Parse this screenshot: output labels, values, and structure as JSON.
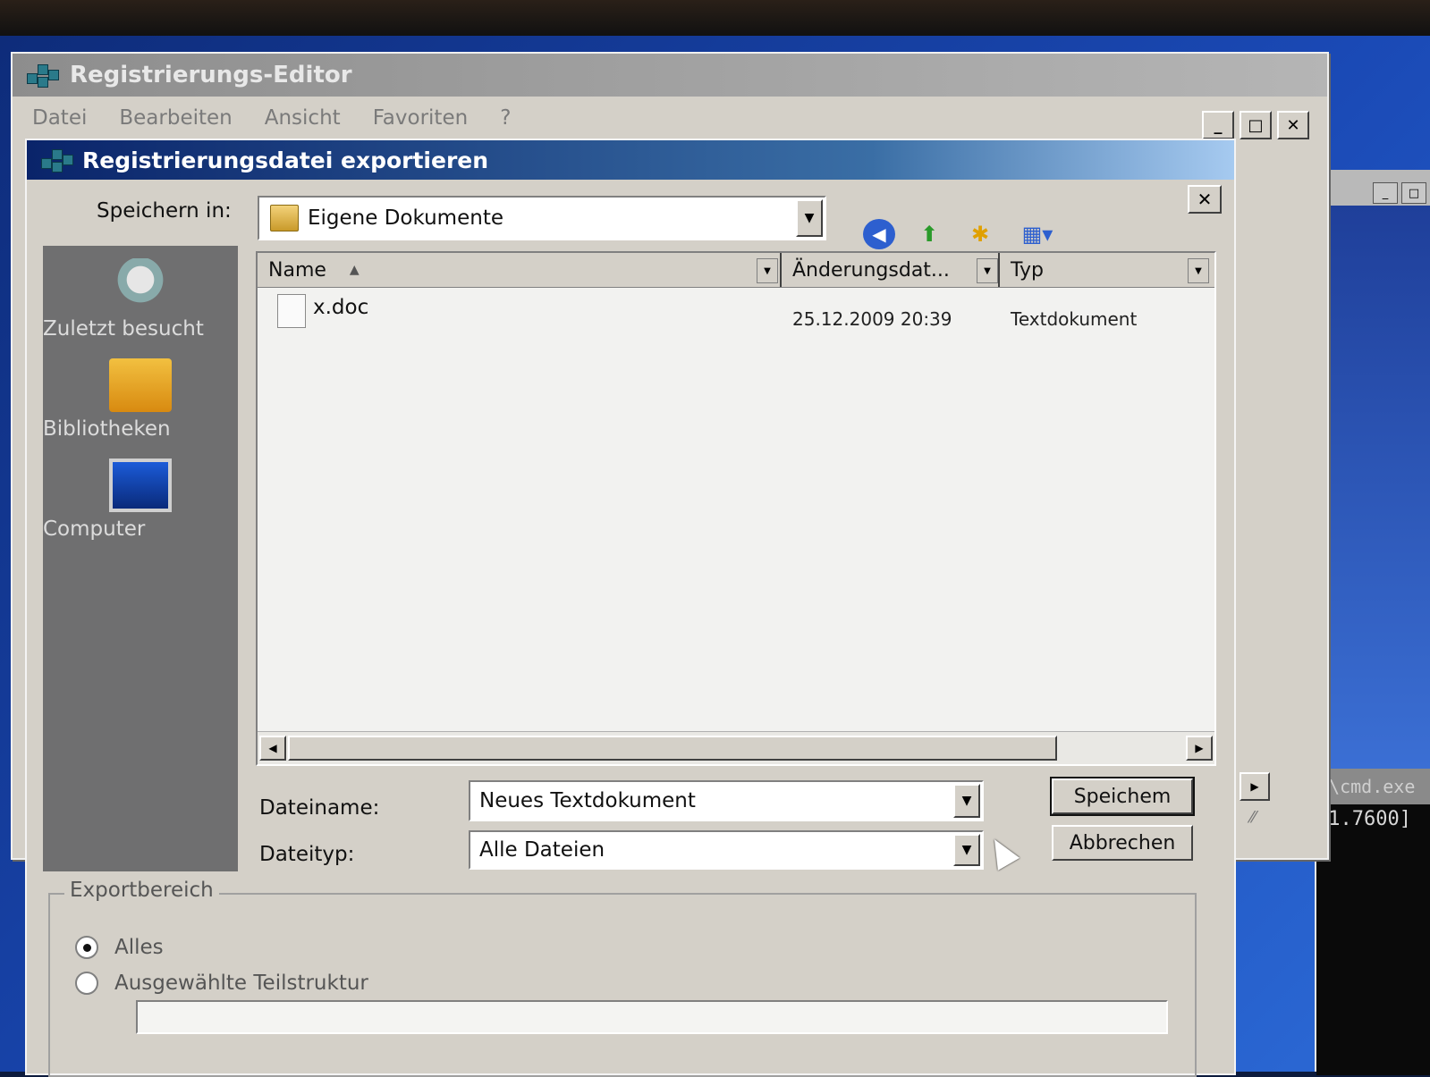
{
  "background_window": {
    "title": "2\\cmd.exe",
    "console_text": ".1.7600]"
  },
  "regedit": {
    "title": "Registrierungs-Editor",
    "menu": [
      "Datei",
      "Bearbeiten",
      "Ansicht",
      "Favoriten",
      "?"
    ]
  },
  "dialog": {
    "title": "Registrierungsdatei exportieren",
    "save_in_label": "Speichern in:",
    "save_in_value": "Eigene Dokumente",
    "places": [
      {
        "label": "Zuletzt besucht",
        "icon": "recent-places-icon"
      },
      {
        "label": "Bibliotheken",
        "icon": "libraries-icon"
      },
      {
        "label": "Computer",
        "icon": "computer-icon"
      }
    ],
    "columns": [
      "Name",
      "Änderungsdat...",
      "Typ"
    ],
    "files": [
      {
        "name": "x.doc",
        "date": "25.12.2009 20:39",
        "type": "Textdokument"
      }
    ],
    "filename_label": "Dateiname:",
    "filename_value": "Neues Textdokument",
    "filetype_label": "Dateityp:",
    "filetype_value": "Alle Dateien",
    "save_button": "Speichem",
    "cancel_button": "Abbrechen",
    "export_range": {
      "legend": "Exportbereich",
      "option_all": "Alles",
      "option_branch": "Ausgewählte Teilstruktur",
      "selected": "Alles",
      "branch_value": ""
    }
  },
  "colors": {
    "dialog_title_start": "#0a246a",
    "dialog_title_end": "#a6caf0",
    "places_bar": "#6f6f70",
    "window_face": "#d4d0c8"
  }
}
